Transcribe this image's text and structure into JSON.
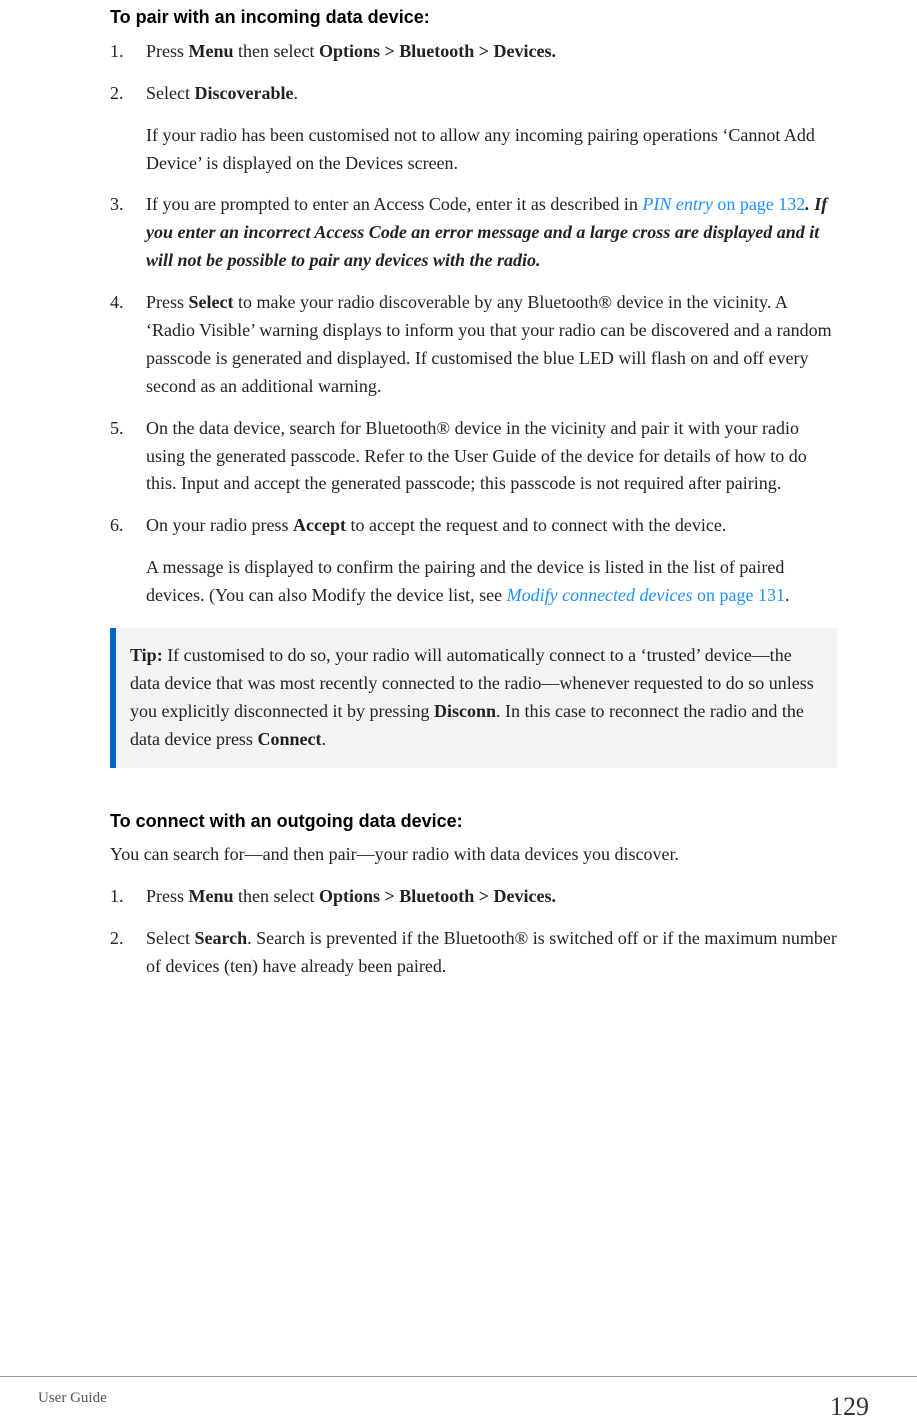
{
  "section1": {
    "heading": "To pair with an incoming data device:",
    "item1": {
      "prefix": "Press ",
      "b1": "Menu",
      "mid": " then select ",
      "b2": "Options > Bluetooth > Devices."
    },
    "item2": {
      "prefix": "Select ",
      "b1": "Discoverable",
      "suffix": ".",
      "follow": "If your radio has been customised not to allow any incoming pairing operations ‘Cannot Add Device’ is displayed on the Devices screen."
    },
    "item3": {
      "p1": "If you are prompted to enter an Access Code, enter it as described in ",
      "link": "PIN entry",
      "link_page": " on page 132",
      "dot": ". ",
      "bi": "If you enter an incorrect Access Code an error message and a large cross are displayed and it will not be possible to pair any devices with the radio."
    },
    "item4": {
      "p1": "Press ",
      "b1": "Select",
      "p2": " to make your radio discoverable by any Bluetooth® device in the vicinity. A ‘Radio Visible’ warning displays to inform you that your radio can be discovered and a random passcode is generated and displayed. If customised the blue LED will flash on and off every second as an additional warning."
    },
    "item5": "On the data device, search for Bluetooth® device in the vicinity and pair it with your radio using the generated passcode. Refer to the User Guide of the device for details of how to do this. Input and accept the generated passcode; this passcode is not required after pairing.",
    "item6": {
      "p1": "On your radio press ",
      "b1": "Accept",
      "p2": " to accept the request and to connect with the device.",
      "follow_p1": "A message is displayed to confirm the pairing and the device is listed in the list of paired devices. (You can also Modify the device list, see ",
      "follow_link": "Modify connected devices",
      "follow_page": " on page 131",
      "follow_suffix": "."
    }
  },
  "tip": {
    "label": "Tip:",
    "p1": "  If customised to do so, your radio will automatically connect to a ‘trusted’ device—the data device that was most recently connected to the radio—whenever requested to do so unless you explicitly disconnected it by pressing ",
    "b1": "Disconn",
    "p2": ". In this case to reconnect the radio and the data device press ",
    "b2": "Connect",
    "p3": "."
  },
  "section2": {
    "heading": "To connect with an outgoing data device:",
    "intro": "You can search for—and then pair—your radio with data devices you discover.",
    "item1": {
      "prefix": "Press ",
      "b1": "Menu",
      "mid": " then select ",
      "b2": "Options > Bluetooth > Devices."
    },
    "item2": {
      "prefix": "Select ",
      "b1": "Search",
      "suffix": ". Search is prevented if the Bluetooth® is switched off or if the maximum number of devices (ten) have already been paired."
    }
  },
  "footer": {
    "left": "User Guide",
    "right": "129"
  }
}
